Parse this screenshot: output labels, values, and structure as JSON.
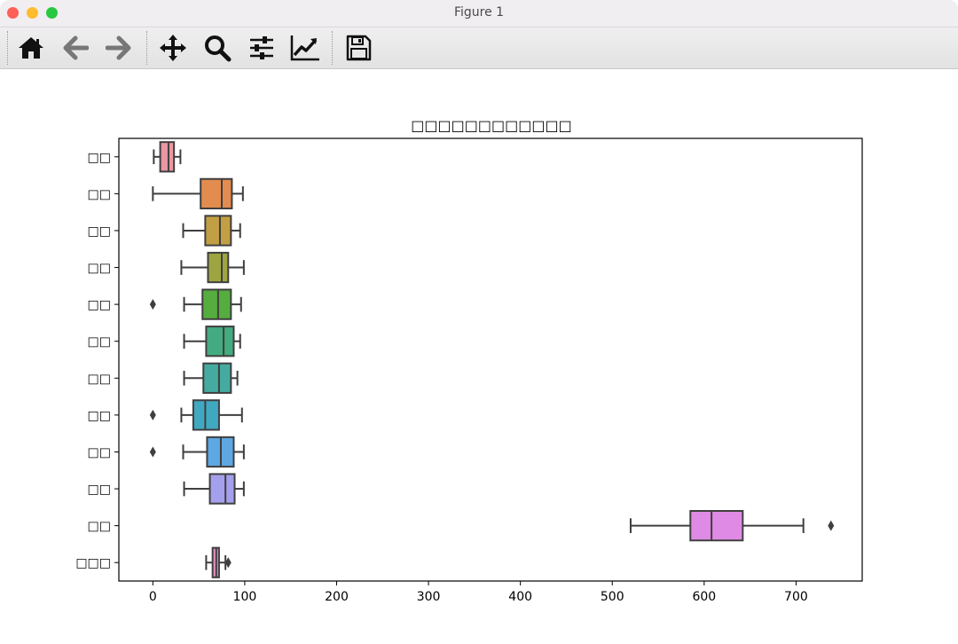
{
  "window": {
    "title": "Figure 1"
  },
  "toolbar": {
    "buttons": [
      {
        "name": "home-icon"
      },
      {
        "name": "back-arrow-icon"
      },
      {
        "name": "forward-arrow-icon"
      },
      {
        "name": "pan-move-icon"
      },
      {
        "name": "zoom-magnifier-icon"
      },
      {
        "name": "configure-subplots-icon"
      },
      {
        "name": "edit-axis-curve-icon"
      },
      {
        "name": "save-disk-icon"
      }
    ]
  },
  "chart_data": {
    "type": "boxplot",
    "orientation": "horizontal",
    "title": "□□□□□□□□□□□□",
    "xlabel": "",
    "ylabel": "",
    "xlim": [
      -37,
      772
    ],
    "xticks": [
      0,
      100,
      200,
      300,
      400,
      500,
      600,
      700
    ],
    "grid": false,
    "categories": [
      "□□",
      "□□",
      "□□",
      "□□",
      "□□",
      "□□",
      "□□",
      "□□",
      "□□",
      "□□",
      "□□",
      "□□□"
    ],
    "boxes": [
      {
        "color": "#ea96a3",
        "whisker_low": 1,
        "q1": 8,
        "median": 17,
        "q3": 23,
        "whisker_high": 30,
        "outliers": []
      },
      {
        "color": "#e38c4f",
        "whisker_low": 0,
        "q1": 52,
        "median": 75,
        "q3": 86,
        "whisker_high": 98,
        "outliers": []
      },
      {
        "color": "#c29f44",
        "whisker_low": 33,
        "q1": 57,
        "median": 73,
        "q3": 85,
        "whisker_high": 95,
        "outliers": []
      },
      {
        "color": "#9ea540",
        "whisker_low": 31,
        "q1": 60,
        "median": 75,
        "q3": 82,
        "whisker_high": 99,
        "outliers": []
      },
      {
        "color": "#56ad3f",
        "whisker_low": 34,
        "q1": 54,
        "median": 71,
        "q3": 85,
        "whisker_high": 96,
        "outliers": [
          0
        ]
      },
      {
        "color": "#44ab80",
        "whisker_low": 34,
        "q1": 58,
        "median": 77,
        "q3": 88,
        "whisker_high": 95,
        "outliers": []
      },
      {
        "color": "#45aba0",
        "whisker_low": 34,
        "q1": 55,
        "median": 72,
        "q3": 85,
        "whisker_high": 92,
        "outliers": []
      },
      {
        "color": "#41a8c2",
        "whisker_low": 31,
        "q1": 44,
        "median": 57,
        "q3": 72,
        "whisker_high": 97,
        "outliers": [
          0
        ]
      },
      {
        "color": "#5da7e2",
        "whisker_low": 33,
        "q1": 59,
        "median": 74,
        "q3": 88,
        "whisker_high": 99,
        "outliers": [
          0
        ]
      },
      {
        "color": "#a4a0ec",
        "whisker_low": 34,
        "q1": 62,
        "median": 79,
        "q3": 89,
        "whisker_high": 99,
        "outliers": []
      },
      {
        "color": "#df8be6",
        "whisker_low": 520,
        "q1": 585,
        "median": 608,
        "q3": 642,
        "whisker_high": 708,
        "outliers": [
          738
        ]
      },
      {
        "color": "#e88fc6",
        "whisker_low": 58,
        "q1": 65,
        "median": 69,
        "q3": 72,
        "whisker_high": 79,
        "outliers": [
          82
        ]
      }
    ]
  }
}
